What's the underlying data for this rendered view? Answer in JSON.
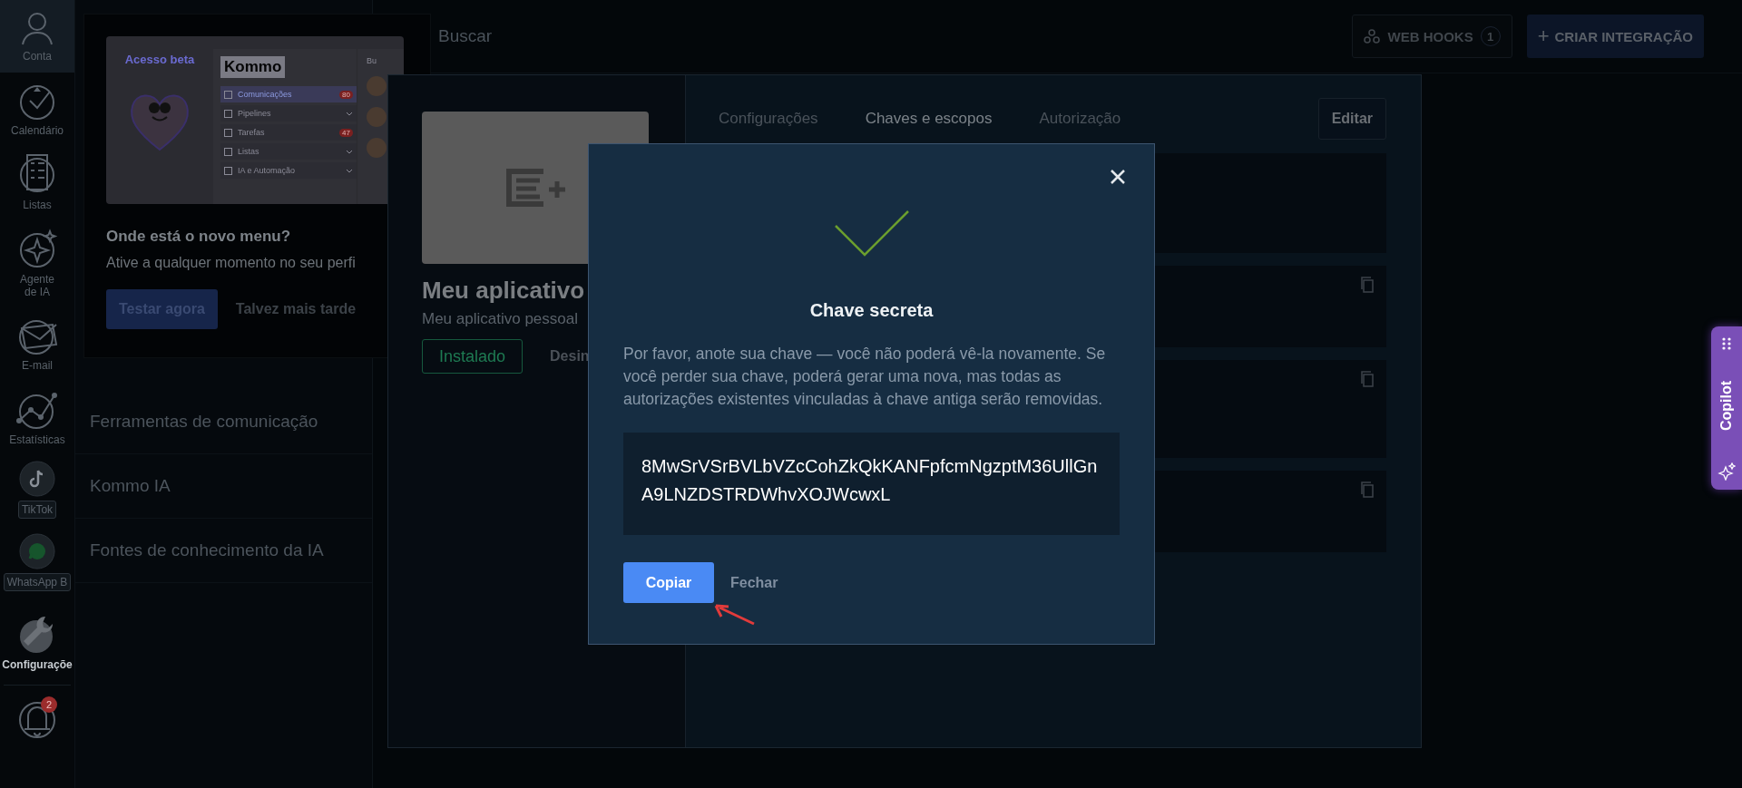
{
  "nav": {
    "items": [
      {
        "kind": "account",
        "label": "Conta",
        "selected": false
      },
      {
        "kind": "calendar",
        "label": "Calendário",
        "selected": false
      },
      {
        "kind": "lists",
        "label": "Listas",
        "selected": false
      },
      {
        "kind": "agent",
        "label": "Agente de IA",
        "selected": false
      },
      {
        "kind": "mail",
        "label": "E-mail",
        "selected": false
      },
      {
        "kind": "stats",
        "label": "Estatísticas",
        "selected": false
      },
      {
        "kind": "tiktok",
        "label": "TikTok",
        "selected": false
      },
      {
        "kind": "whatsapp",
        "label": "WhatsApp B",
        "selected": false
      },
      {
        "kind": "settings",
        "label": "Configuraçõe",
        "selected": true
      }
    ],
    "notifications": {
      "badge": "2"
    }
  },
  "settings_menu": [
    "Ferramentas de comunicação",
    "Kommo IA",
    "Fontes de conhecimento da IA"
  ],
  "top_bar": {
    "search_placeholder": "Buscar",
    "webhooks": {
      "label": "WEB HOOKS",
      "count": "1"
    },
    "create": {
      "icon": "+",
      "label": "CRIAR INTEGRAÇÃO"
    }
  },
  "beta_popup": {
    "preview": {
      "badge": "Acesso beta",
      "logo": "Kommo",
      "search": "Bu",
      "menu": [
        {
          "kind": "count",
          "label": "Comunicações",
          "count": "80",
          "selected": true
        },
        {
          "kind": "dropdown",
          "label": "Pipelines",
          "selected": false
        },
        {
          "kind": "count",
          "label": "Tarefas",
          "count": "47",
          "selected": false
        },
        {
          "kind": "dropdown",
          "label": "Listas",
          "selected": false
        },
        {
          "kind": "dropdown",
          "label": "IA e Automação",
          "selected": false
        }
      ]
    },
    "title": "Onde está o novo menu?",
    "text": "Ative a qualquer momento no seu perfi",
    "primary": "Testar agora",
    "secondary": "Talvez mais tarde"
  },
  "app_panel": {
    "name": "Meu aplicativo",
    "description": "Meu aplicativo pessoal",
    "status": "Instalado",
    "uninstall": "Desin",
    "tabs": [
      {
        "label": "Configurações",
        "selected": false
      },
      {
        "label": "Chaves e escopos",
        "selected": true
      },
      {
        "label": "Autorização",
        "selected": false
      }
    ],
    "edit": "Editar",
    "fields": [
      {
        "copyable": false
      },
      {
        "copyable": true
      },
      {
        "copyable": true
      },
      {
        "copyable": true
      }
    ]
  },
  "modal": {
    "title": "Chave secreta",
    "text": "Por favor, anote sua chave — você não poderá vê-la novamente. Se você perder sua chave, poderá gerar uma nova, mas todas as autorizações existentes vinculadas à chave antiga serão removidas.",
    "key": "8MwSrVSrBVLbVZcCohZkQkKANFpfcmNgzptM36UllGnA9LNZDSTRDWhvXOJWcwxL",
    "copy": "Copiar",
    "close": "Fechar"
  },
  "copilot": {
    "label": "Copilot"
  }
}
